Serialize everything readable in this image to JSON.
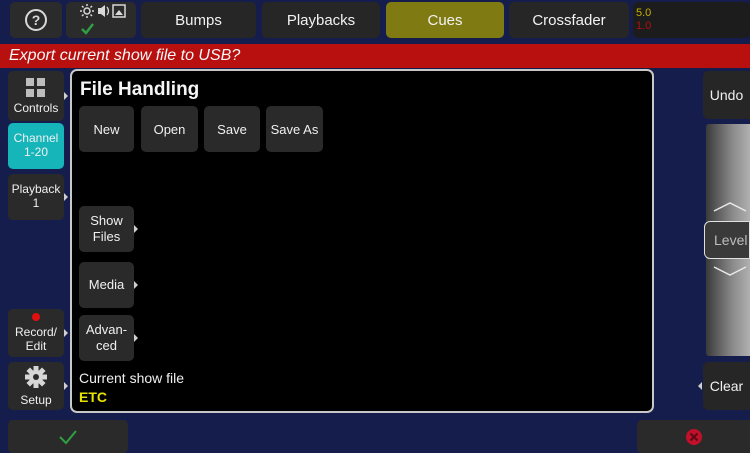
{
  "topbar": {
    "help_icon_glyph": "?",
    "tabs": [
      {
        "label": "Bumps",
        "active": false
      },
      {
        "label": "Playbacks",
        "active": false
      },
      {
        "label": "Cues",
        "active": true
      },
      {
        "label": "Crossfader",
        "active": false
      }
    ],
    "crossfader_values": {
      "top": "5.0",
      "bottom": "1.0"
    }
  },
  "message": "Export current show file to USB?",
  "sidebar": {
    "items": [
      {
        "label": "Controls",
        "icon": "grid-icon"
      },
      {
        "label": "Channel\n1-20",
        "active": true
      },
      {
        "label": "Playback\n1"
      },
      {
        "label": "Record/\nEdit",
        "icon": "record-dot-icon"
      },
      {
        "label": "Setup",
        "icon": "gear-icon"
      }
    ]
  },
  "panel": {
    "title": "File Handling",
    "file_buttons": [
      "New",
      "Open",
      "Save",
      "Save As"
    ],
    "submenu_buttons": [
      "Show\nFiles",
      "Media",
      "Advan-\nced"
    ],
    "current_show_label": "Current show file",
    "current_show_value": "ETC"
  },
  "right": {
    "undo_label": "Undo",
    "level_label": "Level",
    "clear_label": "Clear"
  },
  "colors": {
    "background": "#141d4b",
    "active_tab": "#7f7a12",
    "active_side": "#15b5ba",
    "message_bar": "#b80f0f",
    "ok_check": "#2ea043",
    "cancel": "#c0102a",
    "current_value": "#e8e000"
  },
  "bottom": {
    "ok_icon": "check-icon",
    "cancel_icon": "cancel-icon"
  }
}
